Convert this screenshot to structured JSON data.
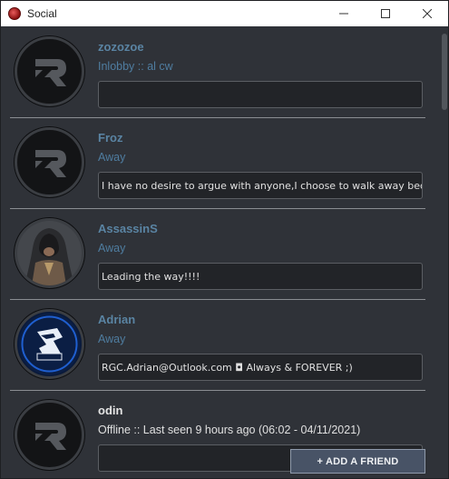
{
  "window": {
    "title": "Social",
    "controls": {
      "minimize": "—",
      "maximize": "☐",
      "close": "✕"
    }
  },
  "friends": [
    {
      "name": "zozozoe",
      "status": "Inlobby :: al cw",
      "message": "",
      "avatar": "r-logo-icon",
      "online": true
    },
    {
      "name": "Froz",
      "status": "Away",
      "message": "I have no desire to argue with anyone,I choose to walk away because",
      "avatar": "r-logo-icon",
      "online": true
    },
    {
      "name": "AssassinS",
      "status": "Away",
      "message": "Leading the way!!!!",
      "avatar": "hooded-assassin-avatar",
      "online": true
    },
    {
      "name": "Adrian",
      "status": "Away",
      "message": "RGC.Adrian@Outlook.com  ◘ Always & FOREVER ;)",
      "avatar": "adrian-logo-avatar",
      "online": true
    },
    {
      "name": "odin",
      "status": "Offline :: Last seen 9 hours ago (06:02 - 04/11/2021)",
      "message": "",
      "avatar": "r-logo-icon",
      "online": false
    }
  ],
  "actions": {
    "add_friend": "+ ADD A FRIEND"
  },
  "colors": {
    "background": "#2f3238",
    "name_online": "#5a84a3",
    "status_online": "#4f7da0",
    "button": "#485366"
  }
}
